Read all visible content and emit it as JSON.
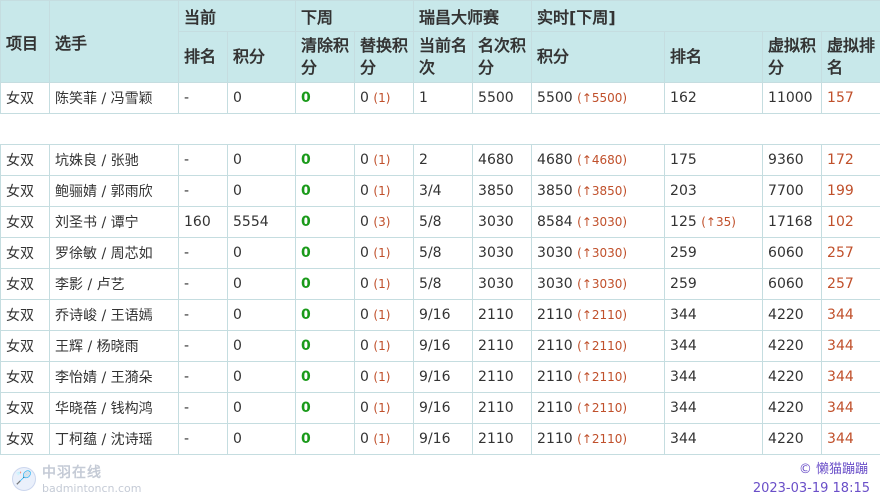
{
  "header": {
    "group1": [
      "项目",
      "选手"
    ],
    "top": [
      "当前",
      "下周",
      "瑞昌大师赛",
      "实时[下周]"
    ],
    "sub": [
      "排名",
      "积分",
      "清除积分",
      "替换积分",
      "当前名次",
      "名次积分",
      "积分",
      "排名",
      "虚拟积分",
      "虚拟排名"
    ]
  },
  "rows": [
    {
      "event": "女双",
      "players": "陈笑菲 / 冯雪颖",
      "rank": "-",
      "points": "0",
      "clear": "0",
      "rep": "0",
      "rep_delta": "(1)",
      "place": "1",
      "place_pts": "5500",
      "rt_pts": "5500",
      "rt_delta": "(↑5500)",
      "rt_rank": "162",
      "rt_rank_delta": "",
      "v_pts": "11000",
      "v_rank": "157"
    },
    {
      "gap": true
    },
    {
      "event": "女双",
      "players": "坑姝良 / 张驰",
      "rank": "-",
      "points": "0",
      "clear": "0",
      "rep": "0",
      "rep_delta": "(1)",
      "place": "2",
      "place_pts": "4680",
      "rt_pts": "4680",
      "rt_delta": "(↑4680)",
      "rt_rank": "175",
      "rt_rank_delta": "",
      "v_pts": "9360",
      "v_rank": "172"
    },
    {
      "event": "女双",
      "players": "鲍骊婧 / 郭雨欣",
      "rank": "-",
      "points": "0",
      "clear": "0",
      "rep": "0",
      "rep_delta": "(1)",
      "place": "3/4",
      "place_pts": "3850",
      "rt_pts": "3850",
      "rt_delta": "(↑3850)",
      "rt_rank": "203",
      "rt_rank_delta": "",
      "v_pts": "7700",
      "v_rank": "199"
    },
    {
      "event": "女双",
      "players": "刘圣书 / 谭宁",
      "rank": "160",
      "points": "5554",
      "clear": "0",
      "rep": "0",
      "rep_delta": "(3)",
      "place": "5/8",
      "place_pts": "3030",
      "rt_pts": "8584",
      "rt_delta": "(↑3030)",
      "rt_rank": "125",
      "rt_rank_delta": "(↑35)",
      "v_pts": "17168",
      "v_rank": "102"
    },
    {
      "event": "女双",
      "players": "罗徐敏 / 周芯如",
      "rank": "-",
      "points": "0",
      "clear": "0",
      "rep": "0",
      "rep_delta": "(1)",
      "place": "5/8",
      "place_pts": "3030",
      "rt_pts": "3030",
      "rt_delta": "(↑3030)",
      "rt_rank": "259",
      "rt_rank_delta": "",
      "v_pts": "6060",
      "v_rank": "257"
    },
    {
      "event": "女双",
      "players": "李影 / 卢艺",
      "rank": "-",
      "points": "0",
      "clear": "0",
      "rep": "0",
      "rep_delta": "(1)",
      "place": "5/8",
      "place_pts": "3030",
      "rt_pts": "3030",
      "rt_delta": "(↑3030)",
      "rt_rank": "259",
      "rt_rank_delta": "",
      "v_pts": "6060",
      "v_rank": "257"
    },
    {
      "event": "女双",
      "players": "乔诗峻 / 王语嫣",
      "rank": "-",
      "points": "0",
      "clear": "0",
      "rep": "0",
      "rep_delta": "(1)",
      "place": "9/16",
      "place_pts": "2110",
      "rt_pts": "2110",
      "rt_delta": "(↑2110)",
      "rt_rank": "344",
      "rt_rank_delta": "",
      "v_pts": "4220",
      "v_rank": "344"
    },
    {
      "event": "女双",
      "players": "王辉 / 杨晓雨",
      "rank": "-",
      "points": "0",
      "clear": "0",
      "rep": "0",
      "rep_delta": "(1)",
      "place": "9/16",
      "place_pts": "2110",
      "rt_pts": "2110",
      "rt_delta": "(↑2110)",
      "rt_rank": "344",
      "rt_rank_delta": "",
      "v_pts": "4220",
      "v_rank": "344"
    },
    {
      "event": "女双",
      "players": "李怡婧 / 王漪朵",
      "rank": "-",
      "points": "0",
      "clear": "0",
      "rep": "0",
      "rep_delta": "(1)",
      "place": "9/16",
      "place_pts": "2110",
      "rt_pts": "2110",
      "rt_delta": "(↑2110)",
      "rt_rank": "344",
      "rt_rank_delta": "",
      "v_pts": "4220",
      "v_rank": "344"
    },
    {
      "event": "女双",
      "players": "华晓蓓 / 钱构鸿",
      "rank": "-",
      "points": "0",
      "clear": "0",
      "rep": "0",
      "rep_delta": "(1)",
      "place": "9/16",
      "place_pts": "2110",
      "rt_pts": "2110",
      "rt_delta": "(↑2110)",
      "rt_rank": "344",
      "rt_rank_delta": "",
      "v_pts": "4220",
      "v_rank": "344"
    },
    {
      "event": "女双",
      "players": "丁柯蕴 / 沈诗瑶",
      "rank": "-",
      "points": "0",
      "clear": "0",
      "rep": "0",
      "rep_delta": "(1)",
      "place": "9/16",
      "place_pts": "2110",
      "rt_pts": "2110",
      "rt_delta": "(↑2110)",
      "rt_rank": "344",
      "rt_rank_delta": "",
      "v_pts": "4220",
      "v_rank": "344"
    }
  ],
  "footer": {
    "logo_text": "中羽在线",
    "logo_url": "badmintoncn.com",
    "author": "© 懒猫蹦蹦",
    "timestamp": "2023-03-19 18:15"
  }
}
